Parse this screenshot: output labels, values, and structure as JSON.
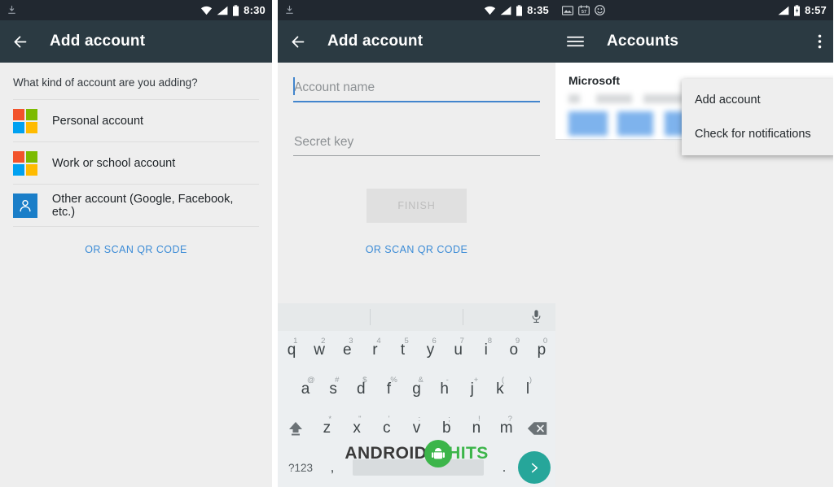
{
  "panels": [
    {
      "status": {
        "time": "8:30",
        "left_icons": [
          "download-icon"
        ],
        "right_icons": [
          "wifi-icon",
          "signal-icon",
          "battery-icon"
        ]
      },
      "toolbar": {
        "title": "Add account",
        "nav_icon": "back-arrow-icon"
      },
      "prompt": "What kind of account are you adding?",
      "accounts": [
        {
          "label": "Personal account",
          "icon": "microsoft-logo-icon"
        },
        {
          "label": "Work or school account",
          "icon": "microsoft-logo-icon"
        },
        {
          "label": "Other account (Google, Facebook, etc.)",
          "icon": "person-icon"
        }
      ],
      "qr_link": "OR SCAN QR CODE"
    },
    {
      "status": {
        "time": "8:35",
        "left_icons": [
          "download-icon"
        ],
        "right_icons": [
          "wifi-icon",
          "signal-icon",
          "battery-icon"
        ]
      },
      "toolbar": {
        "title": "Add account",
        "nav_icon": "back-arrow-icon"
      },
      "fields": [
        {
          "placeholder": "Account name",
          "value": "",
          "focused": true
        },
        {
          "placeholder": "Secret key",
          "value": "",
          "focused": false
        }
      ],
      "finish_label": "FINISH",
      "qr_link": "OR SCAN QR CODE",
      "keyboard": {
        "row1": [
          {
            "k": "q",
            "s": "1"
          },
          {
            "k": "w",
            "s": "2"
          },
          {
            "k": "e",
            "s": "3"
          },
          {
            "k": "r",
            "s": "4"
          },
          {
            "k": "t",
            "s": "5"
          },
          {
            "k": "y",
            "s": "6"
          },
          {
            "k": "u",
            "s": "7"
          },
          {
            "k": "i",
            "s": "8"
          },
          {
            "k": "o",
            "s": "9"
          },
          {
            "k": "p",
            "s": "0"
          }
        ],
        "row2": [
          {
            "k": "a",
            "s": "@"
          },
          {
            "k": "s",
            "s": "#"
          },
          {
            "k": "d",
            "s": "$"
          },
          {
            "k": "f",
            "s": "%"
          },
          {
            "k": "g",
            "s": "&"
          },
          {
            "k": "h",
            "s": "-"
          },
          {
            "k": "j",
            "s": "+"
          },
          {
            "k": "k",
            "s": "("
          },
          {
            "k": "l",
            "s": ")"
          }
        ],
        "row3": [
          {
            "k": "z",
            "s": "*"
          },
          {
            "k": "x",
            "s": "\""
          },
          {
            "k": "c",
            "s": "'"
          },
          {
            "k": "v",
            "s": ":"
          },
          {
            "k": "b",
            "s": ";"
          },
          {
            "k": "n",
            "s": "!"
          },
          {
            "k": "m",
            "s": "?"
          }
        ],
        "shift": "shift-icon",
        "backspace": "backspace-icon",
        "symbols_label": "?123",
        "comma": ",",
        "period": ".",
        "enter": "enter-arrow-icon",
        "mic": "microphone-icon"
      }
    },
    {
      "status": {
        "time": "8:57",
        "left_icons": [
          "image-icon",
          "calendar-icon",
          "face-icon"
        ],
        "right_icons": [
          "signal-icon",
          "battery-charging-icon"
        ]
      },
      "toolbar": {
        "title": "Accounts",
        "nav_icon": "hamburger-icon",
        "overflow_icon": "overflow-menu-icon"
      },
      "account_card": {
        "title": "Microsoft",
        "email": "",
        "code": ""
      },
      "menu_items": [
        "Add account",
        "Check for notifications"
      ]
    }
  ],
  "watermark": {
    "text1": "ANDROID",
    "text2": "HITS",
    "icon": "android-logo-icon"
  },
  "colors": {
    "statusbar": "#212830",
    "toolbar": "#2b3a42",
    "accent_blue": "#4285cd",
    "link_blue": "#3b8bd6",
    "enter_teal": "#26a69a",
    "ms_red": "#f2532b",
    "ms_green": "#7cbb00",
    "ms_blue": "#00a1f1",
    "ms_yellow": "#ffbb00",
    "person_tile_blue": "#1a7ec8",
    "watermark_green": "#3cb54a"
  }
}
